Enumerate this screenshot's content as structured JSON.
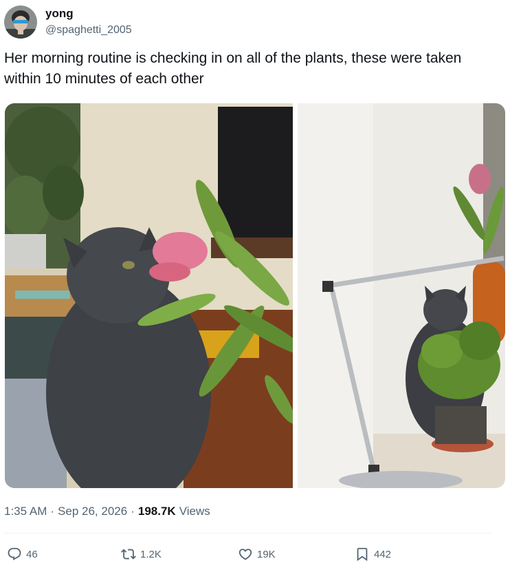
{
  "author": {
    "display_name": "yong",
    "handle": "@spaghetti_2005"
  },
  "tweet": {
    "text": "Her morning routine is checking in on all of the plants, these were taken within 10 minutes of each other"
  },
  "media": [
    {
      "icon": "photo-cat-sniffing-protea"
    },
    {
      "icon": "photo-cat-behind-potted-plant"
    }
  ],
  "meta": {
    "time": "1:35 AM",
    "separator": "·",
    "date": "Sep 26, 2026",
    "views_count": "198.7K",
    "views_label": "Views"
  },
  "actions": {
    "replies": "46",
    "reposts": "1.2K",
    "likes": "19K",
    "bookmarks": "442"
  },
  "colors": {
    "text": "#0f1419",
    "secondary": "#536471",
    "divider": "#eff3f4"
  }
}
